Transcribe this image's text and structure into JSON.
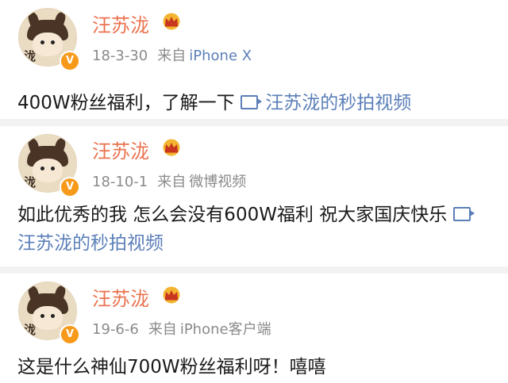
{
  "posts": [
    {
      "name": "汪苏泷",
      "avatar_glyph": "泷",
      "date": "18-3-30",
      "source_prefix": "来自",
      "source": "iPhone X",
      "text": "400W粉丝福利，了解一下",
      "link": "汪苏泷的秒拍视频"
    },
    {
      "name": "汪苏泷",
      "avatar_glyph": "泷",
      "date": "18-10-1",
      "source_prefix": "来自",
      "source": "微博视频",
      "text": "如此优秀的我 怎么会没有600W福利 祝大家国庆快乐",
      "link": "汪苏泷的秒拍视频"
    },
    {
      "name": "汪苏泷",
      "avatar_glyph": "泷",
      "date": "19-6-6",
      "source_prefix": "来自",
      "source": "iPhone客户端",
      "text": "这是什么神仙700W粉丝福利呀！嘻嘻",
      "link": ""
    }
  ],
  "verified_badge": "V",
  "colors": {
    "name": "#eb7350",
    "link": "#5b7fb8",
    "meta": "#8a8a8a",
    "badge": "#f79a1a",
    "divider": "#f2f2f2"
  },
  "icons": {
    "crown": "crown-icon",
    "verified": "verified-badge-icon",
    "video": "video-icon"
  }
}
